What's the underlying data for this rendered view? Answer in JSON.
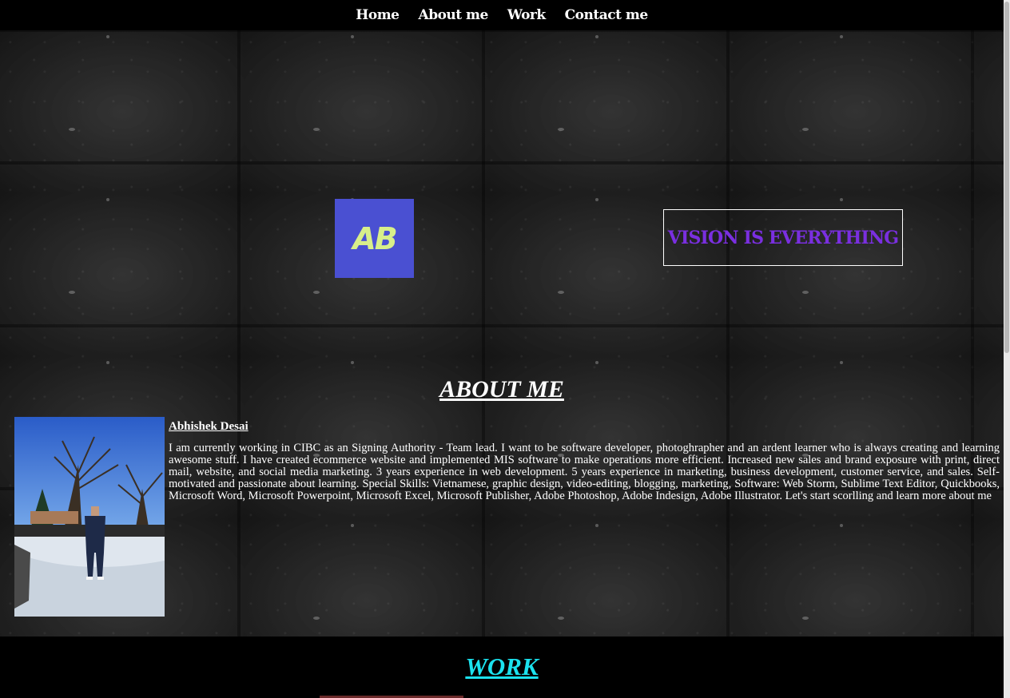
{
  "nav": {
    "items": [
      {
        "label": "Home"
      },
      {
        "label": "About me"
      },
      {
        "label": "Work"
      },
      {
        "label": "Contact me"
      }
    ]
  },
  "hero": {
    "logo_text": "AB",
    "tagline": "VISION IS EVERYTHING"
  },
  "about": {
    "title": "ABOUT ME",
    "name": "Abhishek Desai",
    "bio": "I am currently working in CIBC as an Signing Authority - Team lead. I want to be software developer, photoghrapher and an ardent learner who is always creating and learning awesome stuff. I have created ecommerce website and implemented MIS software to make operations more efficient. Increased new sales and brand exposure with print, direct mail, website, and social media marketing. 3 years experience in web development. 5 years experience in marketing, business development, customer service, and sales. Self-motivated and passionate about learning. Special Skills: Vietnamese, graphic design, video-editing, blogging, marketing, Software: Web Storm, Sublime Text Editor, Quickbooks, Microsoft Word, Microsoft Powerpoint, Microsoft Excel, Microsoft Publisher, Adobe Photoshop, Adobe Indesign, Adobe Illustrator. Let's start scorlling and learn more about me"
  },
  "work": {
    "title": "WORK"
  },
  "colors": {
    "logo_bg": "#4a50d2",
    "logo_text": "#d8ef8a",
    "tagline": "#7a2fe0",
    "work_title": "#1be2ee"
  }
}
